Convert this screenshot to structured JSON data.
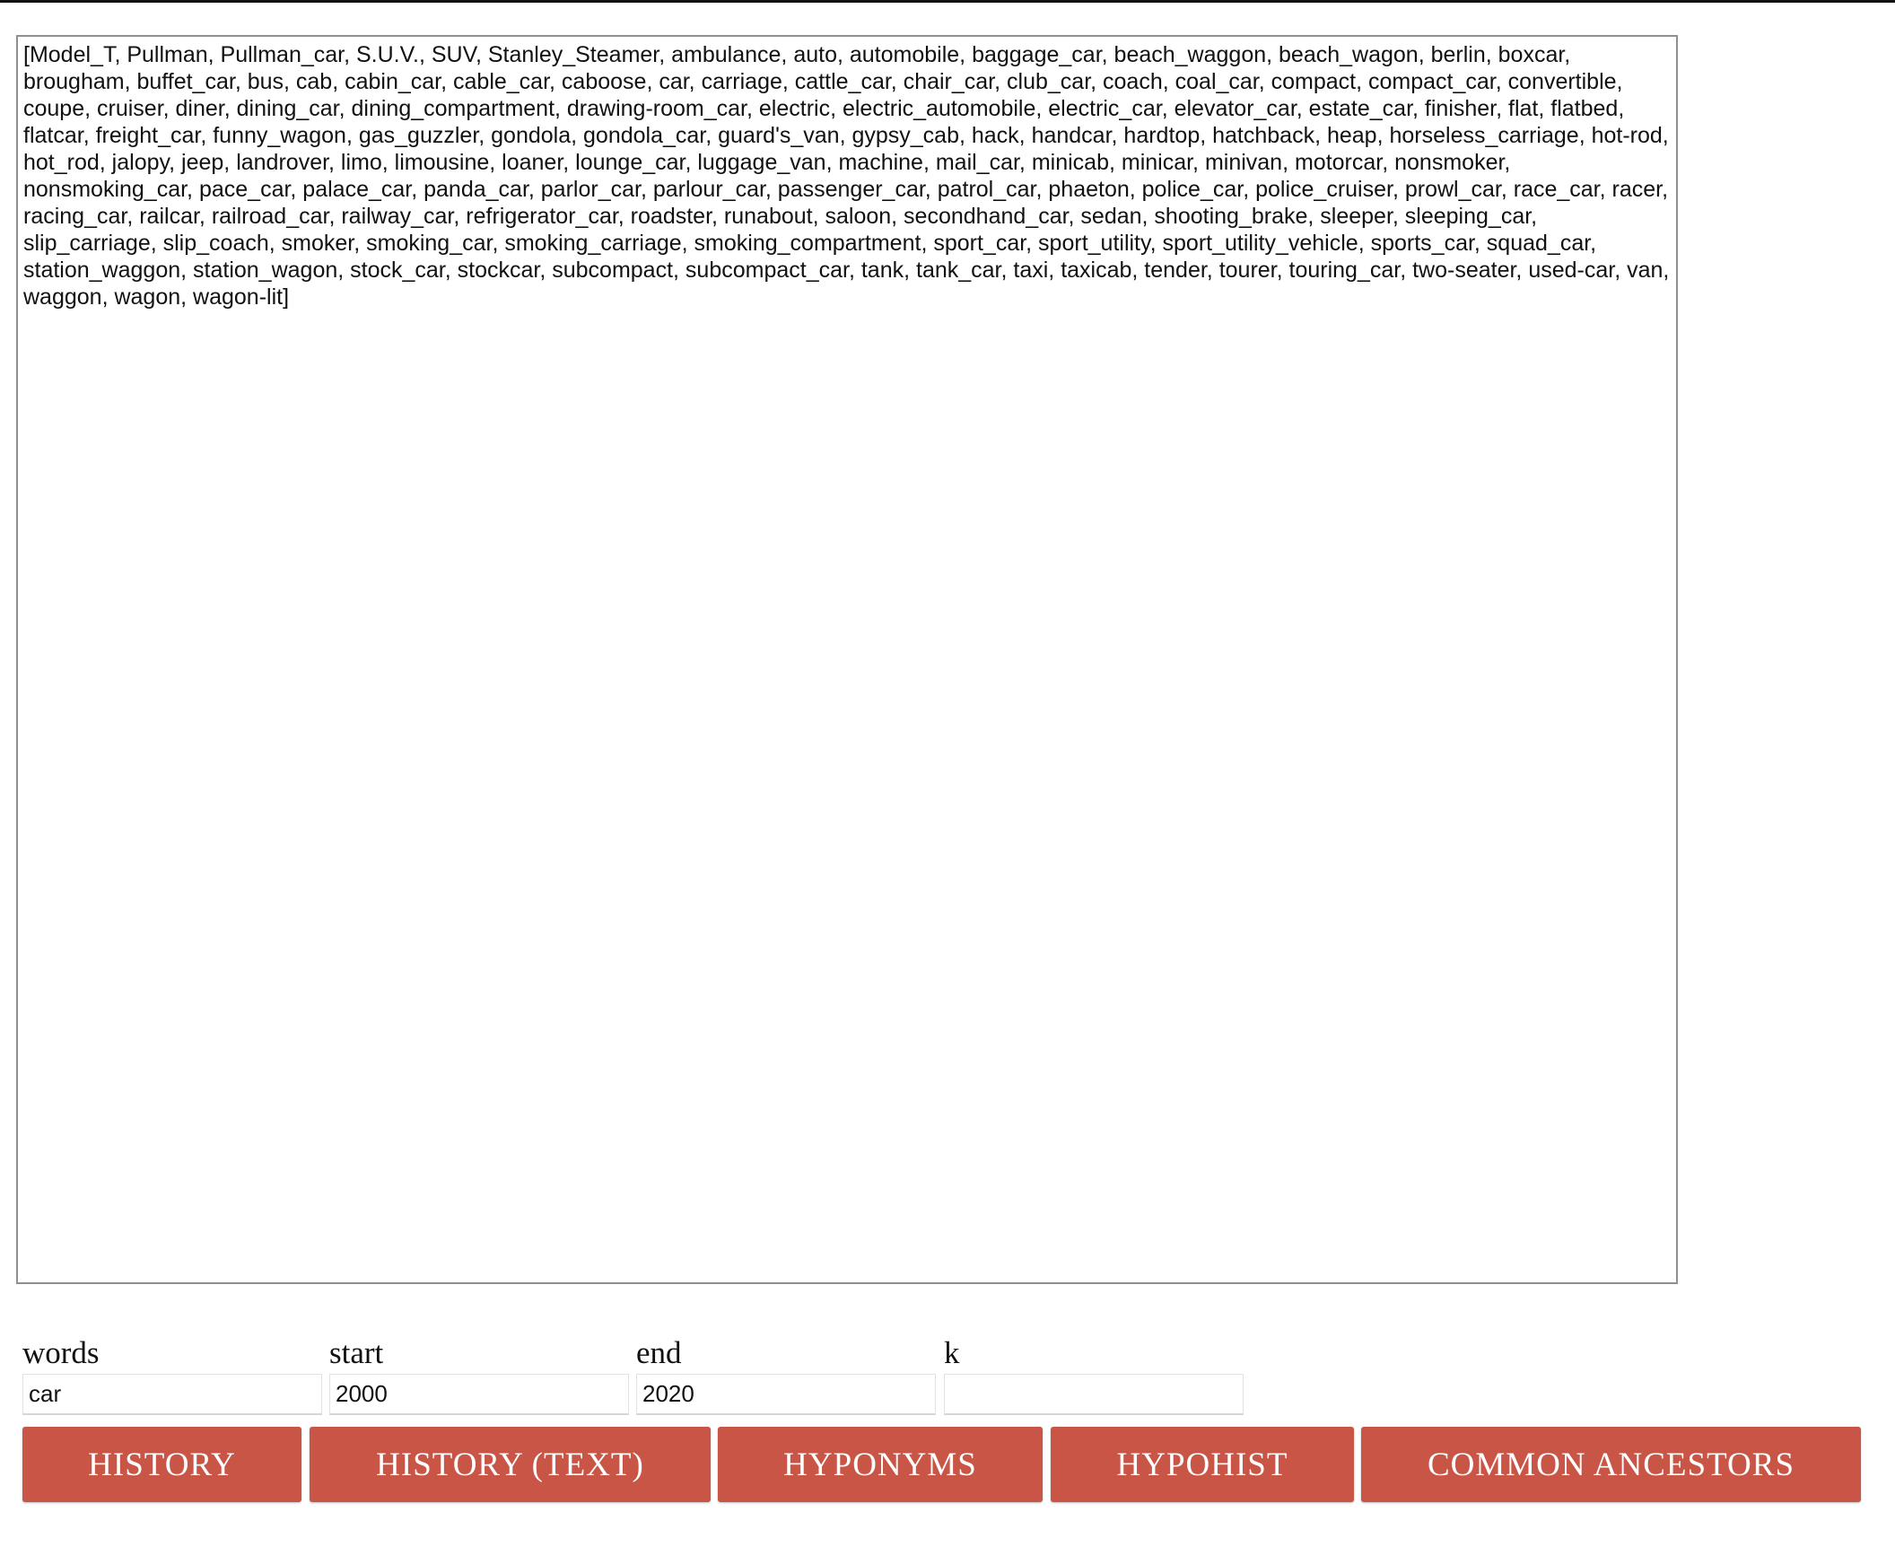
{
  "output": {
    "text": "[Model_T, Pullman, Pullman_car, S.U.V., SUV, Stanley_Steamer, ambulance, auto, automobile, baggage_car, beach_waggon, beach_wagon, berlin, boxcar, brougham, buffet_car, bus, cab, cabin_car, cable_car, caboose, car, carriage, cattle_car, chair_car, club_car, coach, coal_car, compact, compact_car, convertible, coupe, cruiser, diner, dining_car, dining_compartment, drawing-room_car, electric, electric_automobile, electric_car, elevator_car, estate_car, finisher, flat, flatbed, flatcar, freight_car, funny_wagon, gas_guzzler, gondola, gondola_car, guard's_van, gypsy_cab, hack, handcar, hardtop, hatchback, heap, horseless_carriage, hot-rod, hot_rod, jalopy, jeep, landrover, limo, limousine, loaner, lounge_car, luggage_van, machine, mail_car, minicab, minicar, minivan, motorcar, nonsmoker, nonsmoking_car, pace_car, palace_car, panda_car, parlor_car, parlour_car, passenger_car, patrol_car, phaeton, police_car, police_cruiser, prowl_car, race_car, racer, racing_car, railcar, railroad_car, railway_car, refrigerator_car, roadster, runabout, saloon, secondhand_car, sedan, shooting_brake, sleeper, sleeping_car, slip_carriage, slip_coach, smoker, smoking_car, smoking_carriage, smoking_compartment, sport_car, sport_utility, sport_utility_vehicle, sports_car, squad_car, station_waggon, station_wagon, stock_car, stockcar, subcompact, subcompact_car, tank, tank_car, taxi, taxicab, tender, tourer, touring_car, two-seater, used-car, van, waggon, wagon, wagon-lit]"
  },
  "form": {
    "words": {
      "label": "words",
      "value": "car"
    },
    "start": {
      "label": "start",
      "value": "2000"
    },
    "end": {
      "label": "end",
      "value": "2020"
    },
    "k": {
      "label": "k",
      "value": ""
    }
  },
  "buttons": {
    "history": "HISTORY",
    "history_text": "HISTORY (TEXT)",
    "hyponyms": "HYPONYMS",
    "hypohist": "HYPOHIST",
    "common_ancestors": "COMMON ANCESTORS"
  },
  "colors": {
    "button_background": "#c85545",
    "button_text": "#ffffff"
  }
}
